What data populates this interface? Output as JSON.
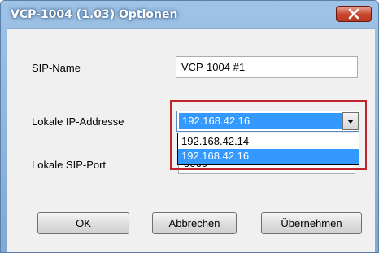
{
  "window": {
    "title": "VCP-1004 (1.03) Optionen"
  },
  "form": {
    "sip_name_label": "SIP-Name",
    "sip_name_value": "VCP-1004 #1",
    "local_ip_label": "Lokale IP-Addresse",
    "local_ip_selected": "192.168.42.16",
    "local_ip_options": [
      "192.168.42.14",
      "192.168.42.16"
    ],
    "local_sip_port_label": "Lokale SIP-Port",
    "local_sip_port_value": "5060"
  },
  "buttons": {
    "ok": "OK",
    "cancel": "Abbrechen",
    "apply": "Übernehmen"
  },
  "colors": {
    "selection": "#3399ff",
    "highlight_frame": "#c0242a",
    "close_button": "#c8442c"
  }
}
